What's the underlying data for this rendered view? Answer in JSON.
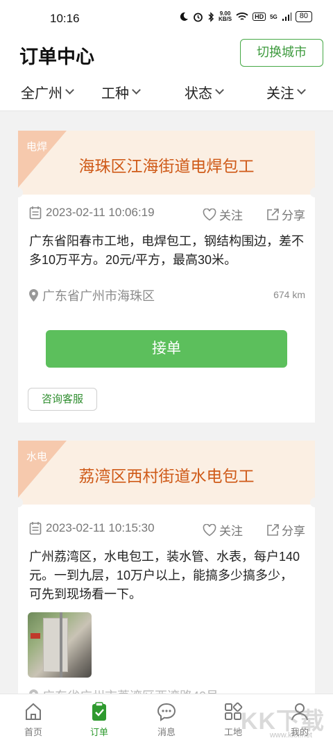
{
  "status_bar": {
    "time": "10:16",
    "net_speed_top": "9.00",
    "net_speed_bottom": "KB/S",
    "hd": "HD",
    "signal": "5G",
    "battery": "80"
  },
  "header": {
    "title": "订单中心",
    "switch_city": "切换城市"
  },
  "filters": [
    {
      "label": "全广州"
    },
    {
      "label": "工种"
    },
    {
      "label": "状态"
    },
    {
      "label": "关注"
    }
  ],
  "orders": [
    {
      "tag": "电焊",
      "title": "海珠区江海街道电焊包工",
      "datetime": "2023-02-11 10:06:19",
      "follow": "关注",
      "share": "分享",
      "description": "广东省阳春市工地，电焊包工，钢结构围边，差不多10万平方。20元/平方，最高30米。",
      "location": "广东省广州市海珠区",
      "distance": "674 km",
      "accept": "接单",
      "consult": "咨询客服"
    },
    {
      "tag": "水电",
      "title": "荔湾区西村街道水电包工",
      "datetime": "2023-02-11 10:15:30",
      "follow": "关注",
      "share": "分享",
      "description": "广州荔湾区，水电包工，装水管、水表，每户140元。一到九层，10万户以上，能搞多少搞多少，可先到现场看一下。",
      "location": "广东省广州市荔湾区西湾路40号"
    }
  ],
  "tabbar": [
    {
      "label": "首页",
      "icon": "home-icon"
    },
    {
      "label": "订单",
      "icon": "order-clipboard-icon",
      "active": true
    },
    {
      "label": "消息",
      "icon": "chat-bubble-icon"
    },
    {
      "label": "工地",
      "icon": "grid-apps-icon"
    },
    {
      "label": "我的",
      "icon": "user-icon"
    }
  ],
  "watermark": {
    "text": "KK下载",
    "sub": "www.kkx.net"
  },
  "colors": {
    "accent_green": "#5cbf5c",
    "title_orange": "#cf5a18",
    "card_head_bg": "#fbefe3"
  }
}
